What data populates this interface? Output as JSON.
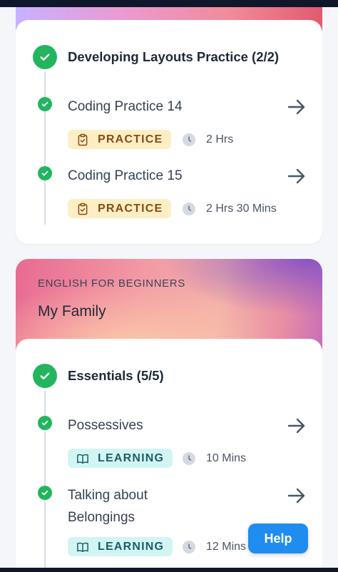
{
  "section1": {
    "title": "Developing Layouts Practice (2/2)",
    "items": [
      {
        "title": "Coding Practice 14",
        "badge": "PRACTICE",
        "duration": "2 Hrs"
      },
      {
        "title": "Coding Practice 15",
        "badge": "PRACTICE",
        "duration": "2 Hrs 30 Mins"
      }
    ]
  },
  "course_banner": {
    "category": "ENGLISH FOR BEGINNERS",
    "title": "My Family"
  },
  "section2": {
    "title": "Essentials (5/5)",
    "items": [
      {
        "title": "Possessives",
        "badge": "LEARNING",
        "duration": "10 Mins"
      },
      {
        "title": "Talking about Belongings",
        "badge": "LEARNING",
        "duration": "12 Mins"
      }
    ]
  },
  "help_button": {
    "label": "Help"
  },
  "colors": {
    "success": "#22b55d",
    "practice_bg": "#fdefc5",
    "learning_bg": "#d2f5f3",
    "help": "#1f8cf0"
  },
  "icons": {
    "section_status": "check-circle-icon",
    "practice_badge": "clipboard-check-icon",
    "learning_badge": "open-book-icon",
    "duration": "clock-icon",
    "navigate": "arrow-right-icon"
  }
}
